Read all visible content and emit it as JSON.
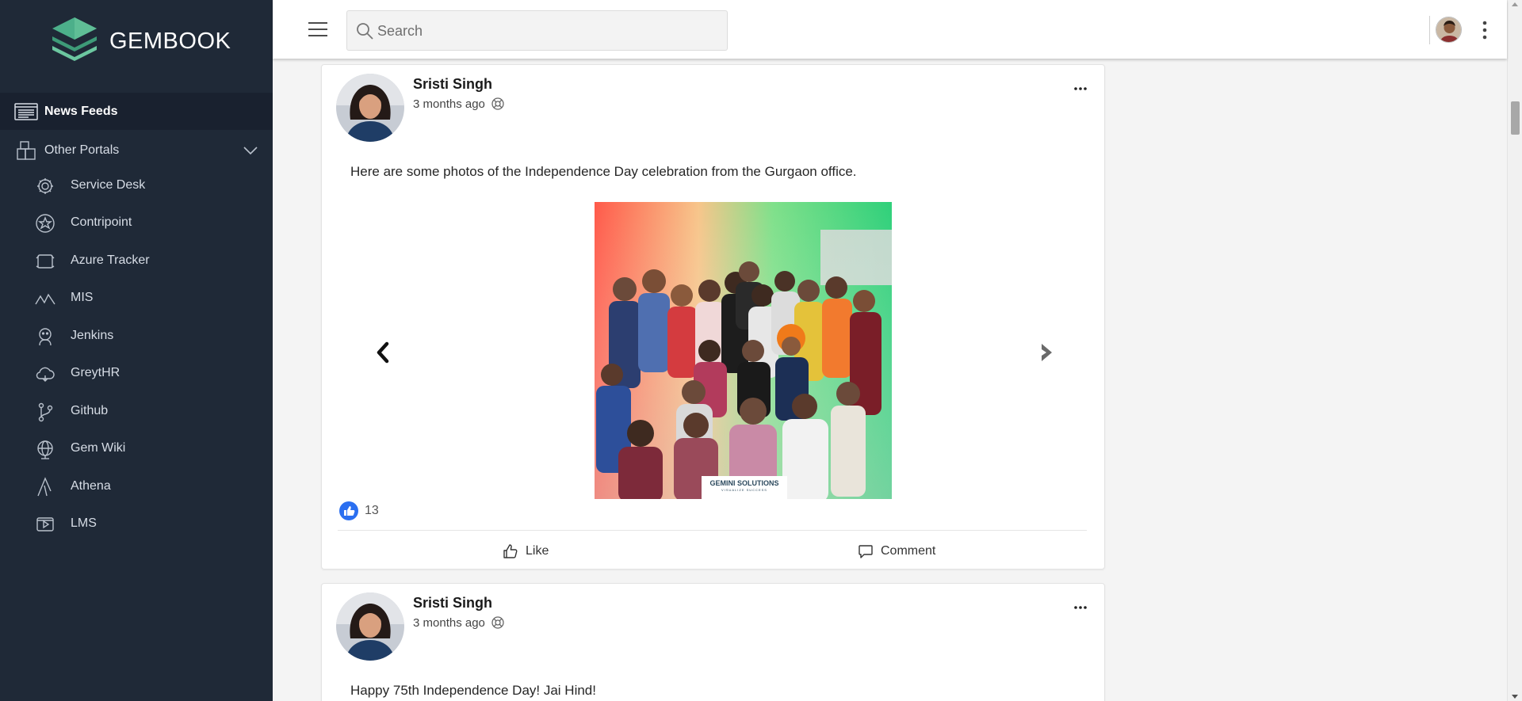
{
  "brand": {
    "name": "GEMBOOK"
  },
  "colors": {
    "sidebar": "#1f2937",
    "sidebar_active": "#19212f",
    "logo_green": "#4caf8a",
    "like_blue": "#2b6ff0"
  },
  "sidebar": {
    "active_item": {
      "label": "News Feeds",
      "icon": "news-feed-icon"
    },
    "group": {
      "label": "Other Portals",
      "icon": "portals-icon",
      "expanded": true
    },
    "items": [
      {
        "label": "Service Desk",
        "icon": "gear-icon"
      },
      {
        "label": "Contripoint",
        "icon": "badge-star-icon"
      },
      {
        "label": "Azure Tracker",
        "icon": "tracker-icon"
      },
      {
        "label": "MIS",
        "icon": "chart-line-icon"
      },
      {
        "label": "Jenkins",
        "icon": "jenkins-icon"
      },
      {
        "label": "GreytHR",
        "icon": "cloud-icon"
      },
      {
        "label": "Github",
        "icon": "git-branch-icon"
      },
      {
        "label": "Gem Wiki",
        "icon": "globe-icon"
      },
      {
        "label": "Athena",
        "icon": "athena-icon"
      },
      {
        "label": "LMS",
        "icon": "video-icon"
      }
    ]
  },
  "header": {
    "search_placeholder": "Search",
    "search_value": ""
  },
  "posts": [
    {
      "author": "Sristi Singh",
      "time": "3 months ago",
      "text": "Here are some photos of the Independence Day celebration from the Gurgaon office.",
      "photo_caption": "GEMINI SOLUTIONS",
      "photo_tagline": "VISUALIZE SUCCESS",
      "likes": "13",
      "actions": {
        "like": "Like",
        "comment": "Comment"
      }
    },
    {
      "author": "Sristi Singh",
      "time": "3 months ago",
      "text": "Happy 75th Independence Day! Jai Hind!"
    }
  ]
}
